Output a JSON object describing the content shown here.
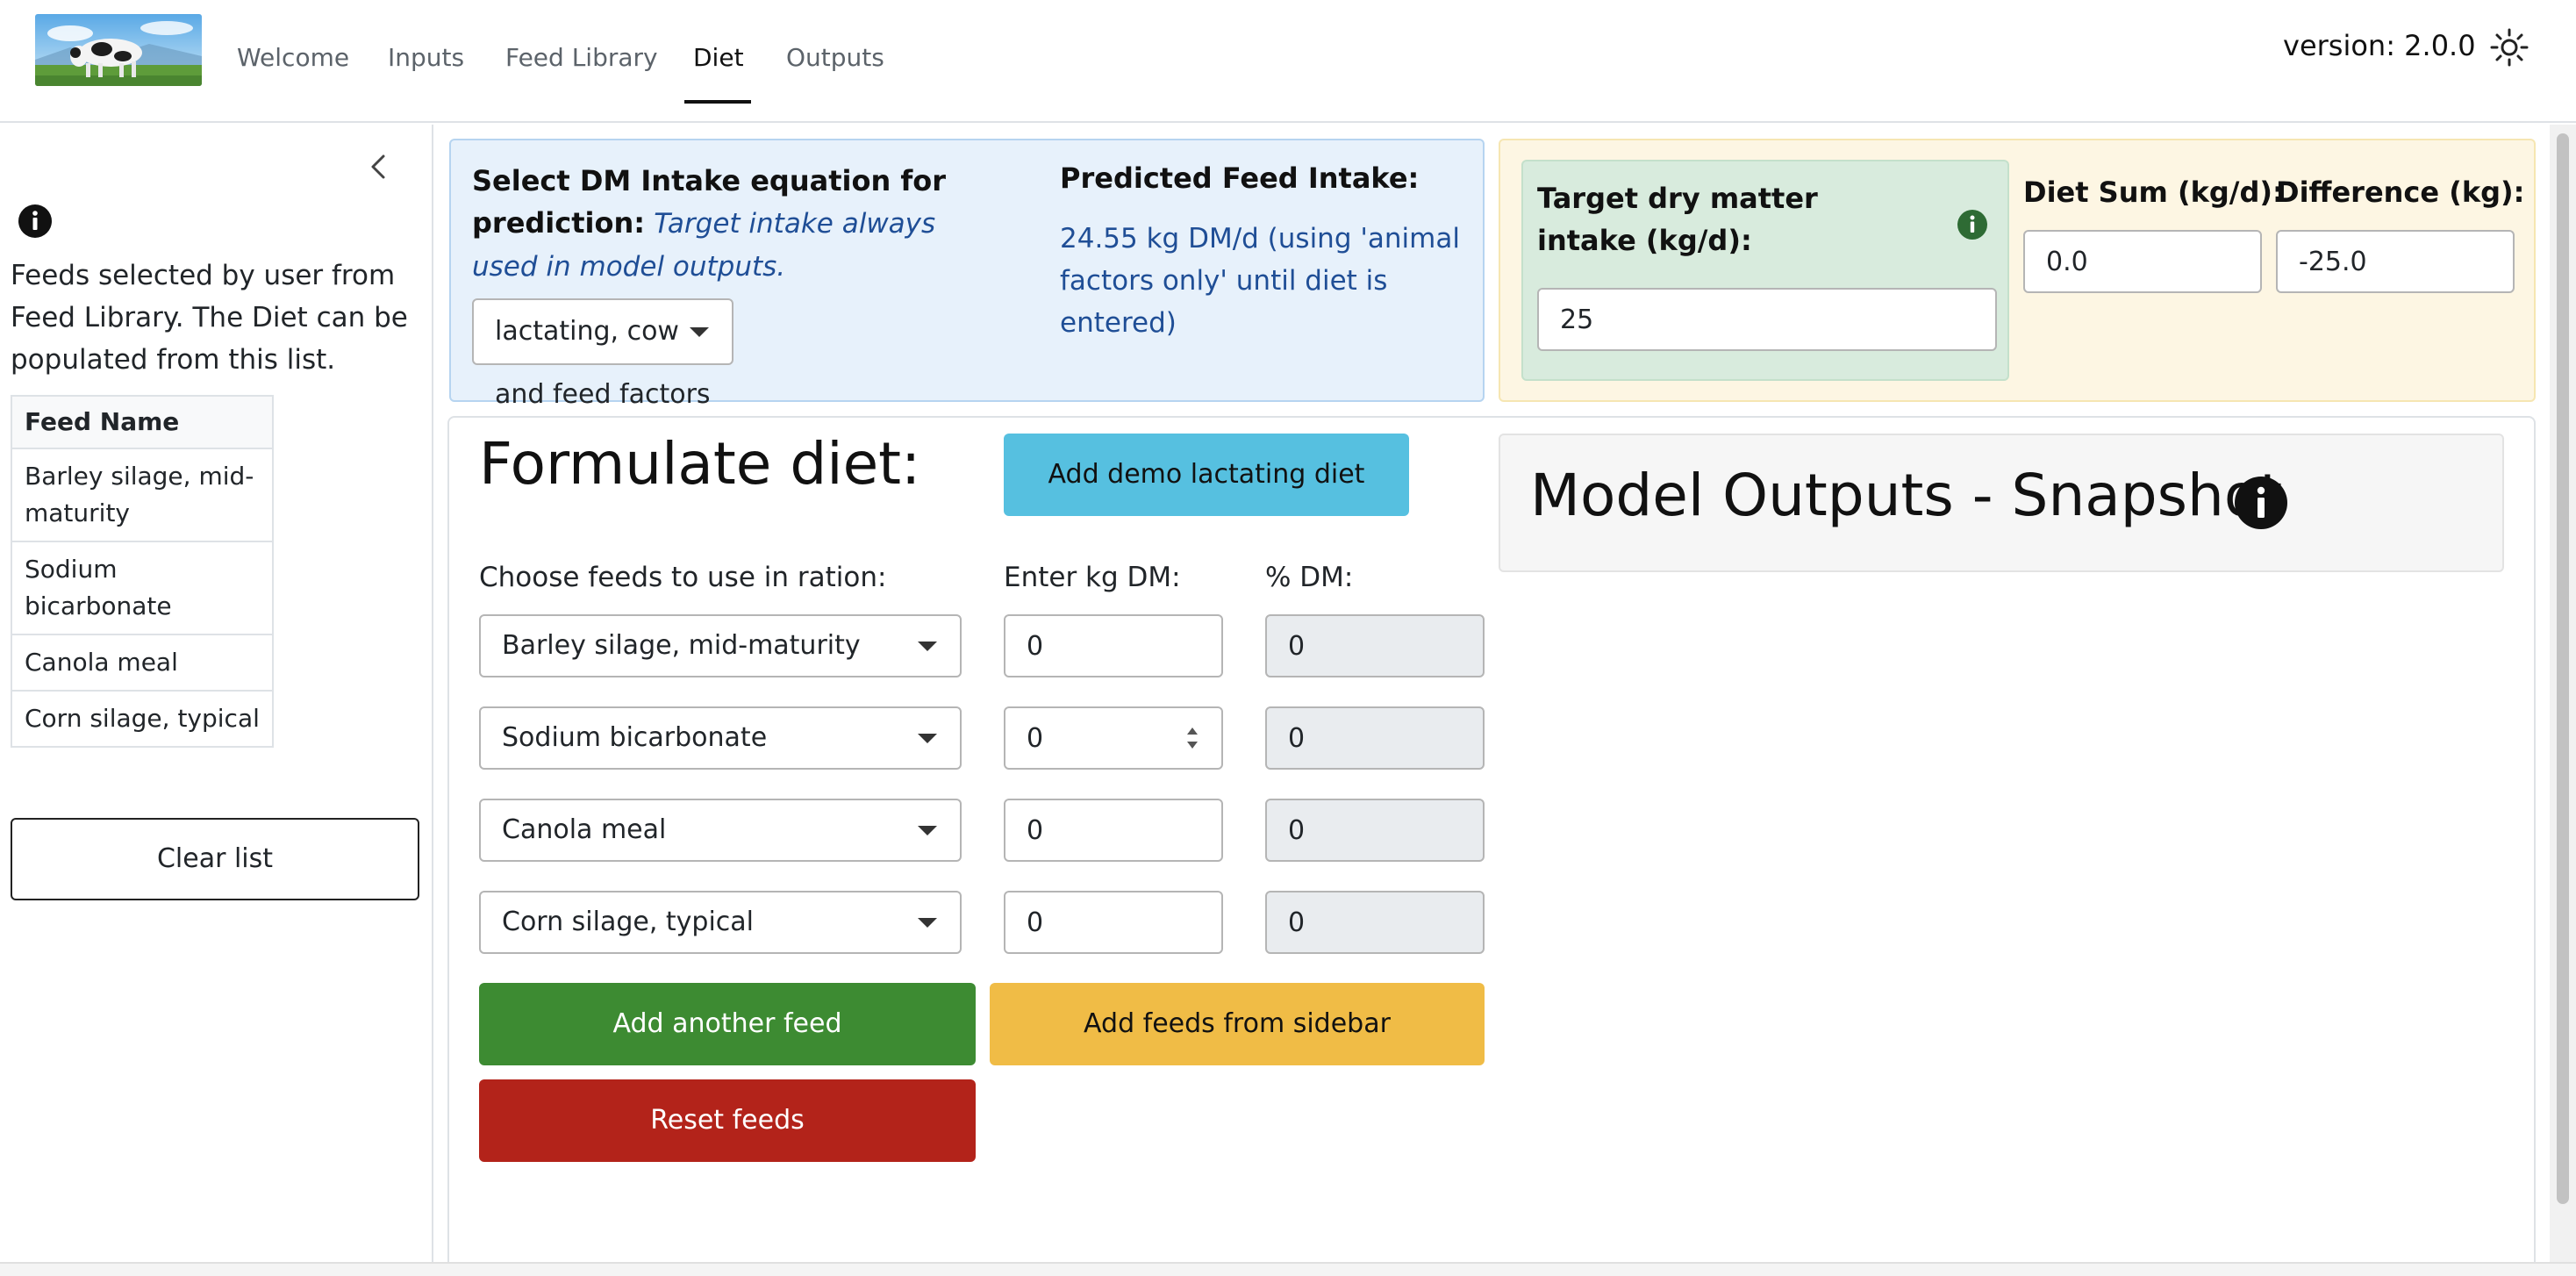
{
  "nav": {
    "items": [
      {
        "label": "Welcome"
      },
      {
        "label": "Inputs"
      },
      {
        "label": "Feed Library"
      },
      {
        "label": "Diet"
      },
      {
        "label": "Outputs"
      }
    ],
    "active": "Diet",
    "version": "version: 2.0.0",
    "theme_icon": "sun-icon"
  },
  "sidebar": {
    "description": "Feeds selected by user from Feed Library. The Diet can be populated from this list.",
    "table_header": "Feed Name",
    "feeds": [
      "Barley silage, mid-maturity",
      "Sodium bicarbonate",
      "Canola meal",
      "Corn silage, typical"
    ],
    "clear_label": "Clear list"
  },
  "dmi": {
    "label_bold": "Select DM Intake equation for prediction:",
    "label_italic": "Target intake always used in model outputs.",
    "selected": "lactating, cow and feed factors",
    "predicted_title": "Predicted Feed Intake:",
    "predicted_value": "24.55 kg DM/d (using 'animal factors only' until diet is entered)"
  },
  "target": {
    "label": "Target dry matter intake (kg/d):",
    "value": "25",
    "diet_sum_label": "Diet Sum (kg/d):",
    "diet_sum_value": "0.0",
    "difference_label": "Difference (kg):",
    "difference_value": "-25.0"
  },
  "formulate": {
    "title": "Formulate diet:",
    "demo_button": "Add demo lactating diet",
    "choose_label": "Choose feeds to use in ration:",
    "kg_label": "Enter kg DM:",
    "pct_label": "% DM:",
    "rows": [
      {
        "feed": "Barley silage, mid-maturity",
        "kg": "0",
        "pct": "0"
      },
      {
        "feed": "Sodium bicarbonate",
        "kg": "0",
        "pct": "0"
      },
      {
        "feed": "Canola meal",
        "kg": "0",
        "pct": "0"
      },
      {
        "feed": "Corn silage, typical",
        "kg": "0",
        "pct": "0"
      }
    ],
    "add_feed": "Add another feed",
    "add_sidebar": "Add feeds from sidebar",
    "reset": "Reset feeds"
  },
  "snapshot": {
    "title": "Model Outputs - Snapshot"
  },
  "colors": {
    "blue_panel": "#e7f1fb",
    "yellow_panel": "#fdf6e3",
    "green_box": "#d8ebdd",
    "demo_button": "#56c0e0",
    "add_feed": "#3d8b32",
    "add_sidebar": "#f0bc46",
    "reset": "#b3231a",
    "accent_text": "#1f4e96"
  }
}
